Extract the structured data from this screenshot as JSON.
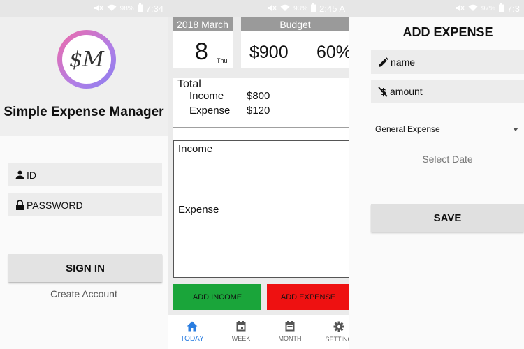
{
  "login_screen": {
    "status_bar": {
      "battery": "98%",
      "time": "7:34"
    },
    "logo_text": "$M",
    "app_title": "Simple Expense Manager",
    "id_field": {
      "label": "ID",
      "icon": "person-icon"
    },
    "password_field": {
      "label": "PASSWORD",
      "icon": "lock-icon"
    },
    "sign_in_label": "SIGN IN",
    "create_account_label": "Create Account"
  },
  "today_screen": {
    "status_bar": {
      "battery": "93%",
      "time": "2:45 A"
    },
    "date_card": {
      "header": "2018  March",
      "day": "8",
      "weekday": "Thu"
    },
    "budget_card": {
      "header": "Budget",
      "amount": "$900",
      "percent": "60%"
    },
    "totals": {
      "title": "Total",
      "income_label": "Income",
      "income_value": "$800",
      "expense_label": "Expense",
      "expense_value": "$120"
    },
    "list": {
      "income_title": "Income",
      "expense_title": "Expense"
    },
    "add_income_label": "ADD INCOME",
    "add_expense_label": "ADD EXPENSE",
    "tabs": [
      {
        "label": "TODAY",
        "icon": "home-icon",
        "active": true
      },
      {
        "label": "WEEK",
        "icon": "calendar-icon",
        "active": false
      },
      {
        "label": "MONTH",
        "icon": "calendar-icon",
        "active": false
      },
      {
        "label": "SETTING",
        "icon": "gear-icon",
        "active": false
      }
    ],
    "colors": {
      "income_button": "#1aa53a",
      "expense_button": "#ee1111",
      "active_tab": "#2a7de0"
    }
  },
  "add_expense_screen": {
    "status_bar": {
      "battery": "97%",
      "time": "7:3"
    },
    "title": "ADD EXPENSE",
    "name_field": {
      "placeholder": "name",
      "icon": "pencil-icon"
    },
    "amount_field": {
      "placeholder": "amount",
      "icon": "dollar-off-icon"
    },
    "category": {
      "selected": "General Expense"
    },
    "select_date_label": "Select Date",
    "save_label": "SAVE"
  }
}
